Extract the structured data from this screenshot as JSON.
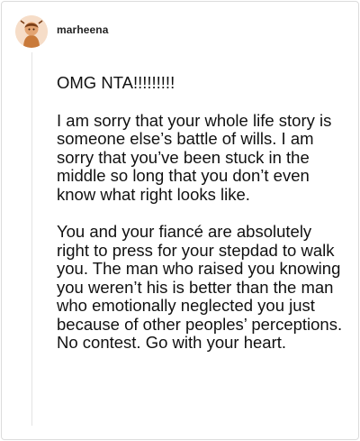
{
  "comment": {
    "username": "marheena",
    "avatar": {
      "icon": "user-avatar-icon",
      "accent": "#c97a3a",
      "background": "#f6ddc8"
    },
    "paragraphs": [
      "OMG NTA!!!!!!!!!",
      "I am sorry that your whole life story is someone else’s battle of wills. I am sorry that you’ve been stuck in the middle so long that you don’t even know what right looks like.",
      "You and your fiancé are absolutely right to press for your stepdad to walk you. The man who raised you knowing you weren’t his is better than the man who emotionally neglected you just because of other peoples’ perceptions. No contest. Go with your heart."
    ]
  }
}
